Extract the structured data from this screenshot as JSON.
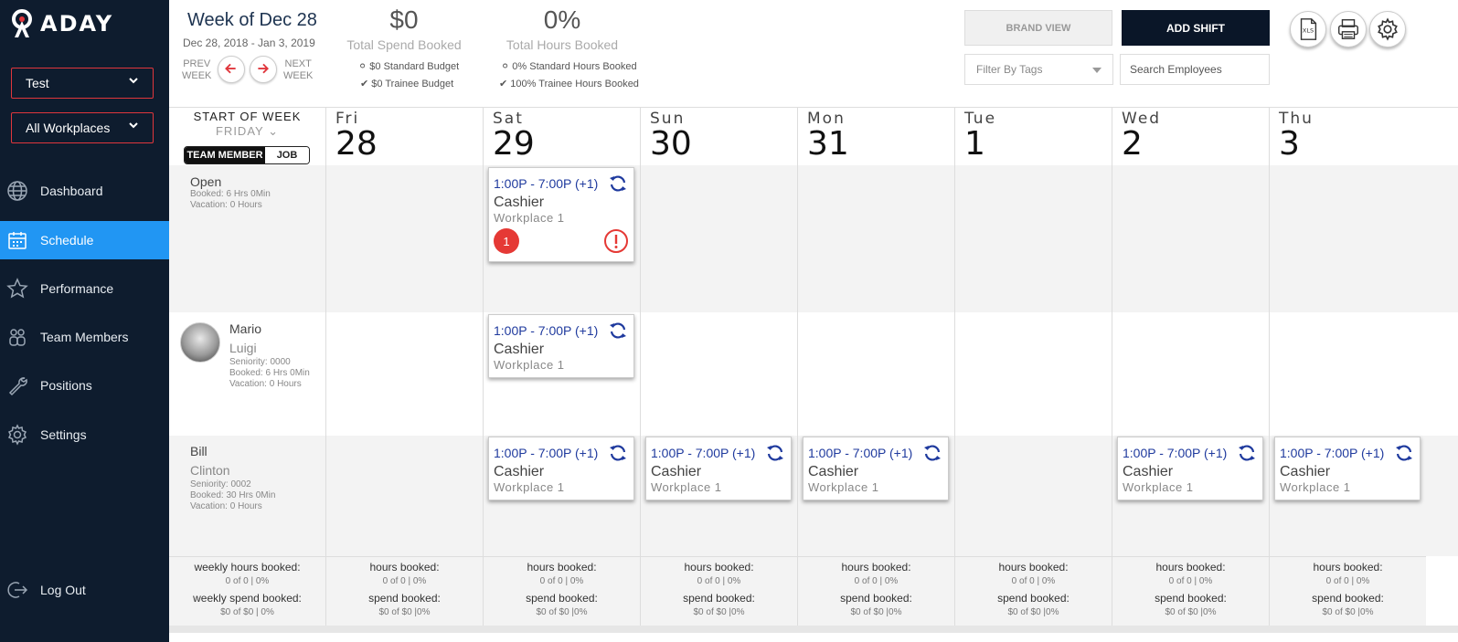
{
  "app": {
    "logo_text": "ADAY"
  },
  "sidebar": {
    "location_select": "Test",
    "workplace_select": "All Workplaces",
    "items": [
      {
        "label": "Dashboard",
        "icon": "globe-icon"
      },
      {
        "label": "Schedule",
        "icon": "calendar-icon",
        "active": true
      },
      {
        "label": "Performance",
        "icon": "star-icon"
      },
      {
        "label": "Team Members",
        "icon": "team-icon"
      },
      {
        "label": "Positions",
        "icon": "wrench-icon"
      },
      {
        "label": "Settings",
        "icon": "gear-icon"
      }
    ],
    "logout": "Log Out"
  },
  "header": {
    "week_title": "Week of Dec 28",
    "week_range": "Dec 28, 2018 - Jan 3, 2019",
    "prev_label": "PREV\nWEEK",
    "prev_line1": "PREV",
    "prev_line2": "WEEK",
    "next_line1": "NEXT",
    "next_line2": "WEEK",
    "spend_value": "$0",
    "spend_label": "Total Spend Booked",
    "spend_standard": "$0 Standard Budget",
    "spend_trainee": "$0 Trainee Budget",
    "hours_value": "0%",
    "hours_label": "Total Hours Booked",
    "hours_standard": "0% Standard Hours Booked",
    "hours_trainee": "100% Trainee Hours Booked",
    "brand_view": "BRAND VIEW",
    "add_shift": "ADD SHIFT",
    "filter_placeholder": "Filter By Tags",
    "search_placeholder": "Search Employees",
    "xls_label": "XLS"
  },
  "grid": {
    "start_of_week_title": "START OF WEEK",
    "start_of_week_day": "FRIDAY",
    "toggle_on": "TEAM MEMBER",
    "toggle_off": "JOB",
    "days": [
      {
        "name": "Fri",
        "num": "28"
      },
      {
        "name": "Sat",
        "num": "29"
      },
      {
        "name": "Sun",
        "num": "30"
      },
      {
        "name": "Mon",
        "num": "31"
      },
      {
        "name": "Tue",
        "num": "1"
      },
      {
        "name": "Wed",
        "num": "2"
      },
      {
        "name": "Thu",
        "num": "3"
      }
    ],
    "rows": [
      {
        "name1": "Open",
        "name2": "",
        "meta": [
          "Booked: 6 Hrs 0Min",
          "Vacation: 0 Hours"
        ]
      },
      {
        "name1": "Mario",
        "name2": "Luigi",
        "meta": [
          "Seniority: 0000",
          "Booked: 6 Hrs 0Min",
          "Vacation: 0 Hours"
        ]
      },
      {
        "name1": "Bill",
        "name2": "Clinton",
        "meta": [
          "Seniority: 0002",
          "Booked: 30 Hrs 0Min",
          "Vacation: 0 Hours"
        ]
      }
    ],
    "shift": {
      "time": "1:00P - 7:00P (+1)",
      "position": "Cashier",
      "workplace": "Workplace 1"
    },
    "open_badge": "1",
    "footer": {
      "weekly_hours_label": "weekly hours booked:",
      "weekly_hours_value": "0 of 0 | 0%",
      "weekly_spend_label": "weekly spend booked:",
      "weekly_spend_value": "$0 of $0 | 0%",
      "hours_label": "hours booked:",
      "hours_value": "0 of 0 | 0%",
      "spend_label": "spend booked:",
      "spend_value": "$0 of $0 |0%"
    }
  },
  "colors": {
    "sidebar_bg": "#0e1c2e",
    "active_nav": "#2196f3",
    "accent_red": "#e0363c",
    "shift_time": "#1f3a9e"
  }
}
